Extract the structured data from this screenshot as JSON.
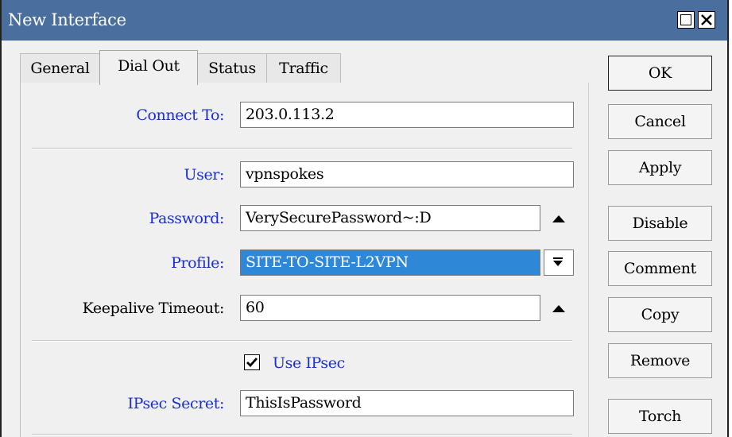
{
  "window": {
    "title": "New Interface"
  },
  "tabs": [
    {
      "label": "General",
      "active": false
    },
    {
      "label": "Dial Out",
      "active": true
    },
    {
      "label": "Status",
      "active": false
    },
    {
      "label": "Traffic",
      "active": false
    }
  ],
  "form": {
    "connect_to": {
      "label": "Connect To:",
      "value": "203.0.113.2"
    },
    "user": {
      "label": "User:",
      "value": "vpnspokes"
    },
    "password": {
      "label": "Password:",
      "value": "VerySecurePassword~:D"
    },
    "profile": {
      "label": "Profile:",
      "value": "SITE-TO-SITE-L2VPN"
    },
    "keepalive": {
      "label": "Keepalive Timeout:",
      "value": "60"
    },
    "use_ipsec": {
      "label": "Use IPsec",
      "checked": true
    },
    "ipsec_secret": {
      "label": "IPsec Secret:",
      "value": "ThisIsPassword"
    }
  },
  "buttons": {
    "ok": "OK",
    "cancel": "Cancel",
    "apply": "Apply",
    "disable": "Disable",
    "comment": "Comment",
    "copy": "Copy",
    "remove": "Remove",
    "torch": "Torch"
  },
  "colors": {
    "titlebar": "#4a6f9e",
    "label_blue": "#1a2fd1",
    "selection": "#2f87d8"
  }
}
